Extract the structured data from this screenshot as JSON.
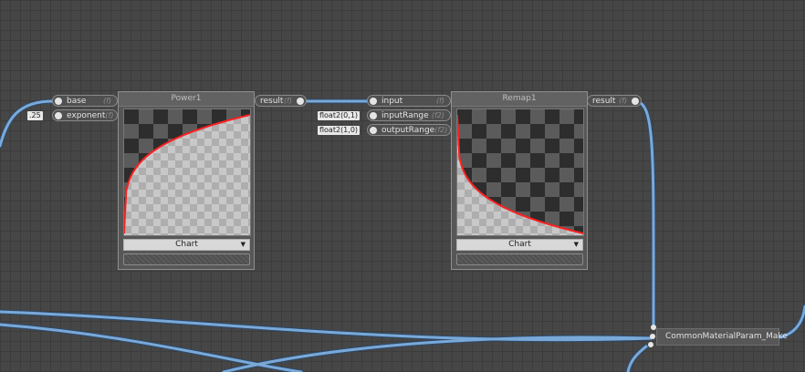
{
  "power_node": {
    "title": "Power1",
    "inputs": [
      {
        "label": "base",
        "type": "(f)"
      },
      {
        "label": "exponent",
        "type": "(f)"
      }
    ],
    "output": {
      "label": "result",
      "type": "(f)"
    },
    "exponent_const": ".25",
    "preview_mode": "Chart"
  },
  "remap_node": {
    "title": "Remap1",
    "inputs": [
      {
        "label": "input",
        "type": "(f)"
      },
      {
        "label": "inputRange",
        "type": "(f2)"
      },
      {
        "label": "outputRange",
        "type": "(f2)"
      }
    ],
    "output": {
      "label": "result",
      "type": "(f)"
    },
    "input_range_const": "float2(0,1)",
    "output_range_const": "float2(1,0)",
    "preview_mode": "Chart"
  },
  "make_node": {
    "title": "CommonMaterialParam_Make"
  },
  "colors": {
    "wire": "#7aa9d8",
    "curve": "#ff2020"
  }
}
